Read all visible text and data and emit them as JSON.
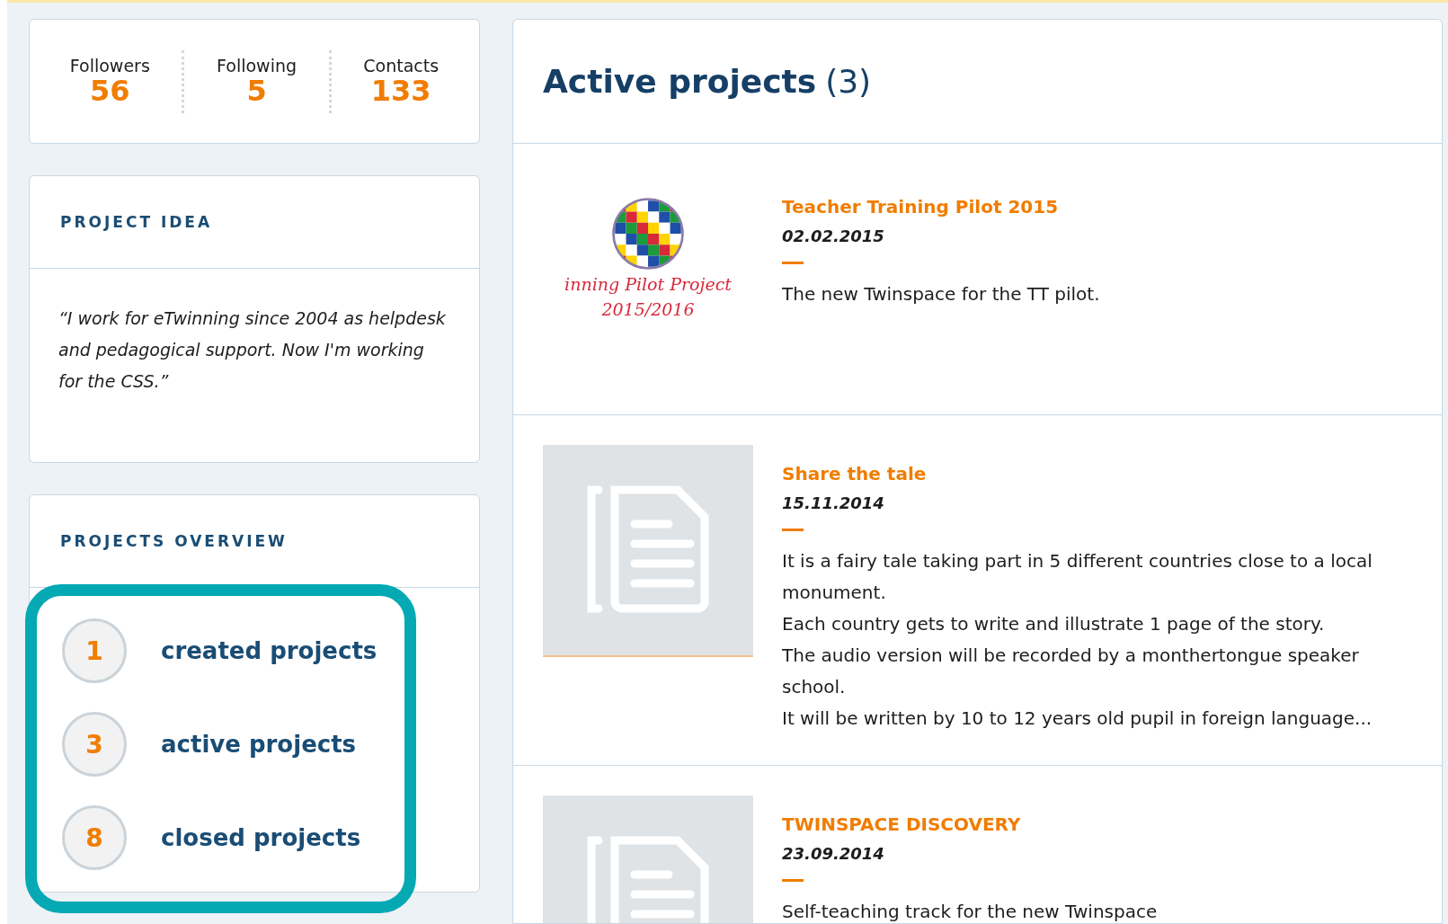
{
  "stats": [
    {
      "label": "Followers",
      "value": "56"
    },
    {
      "label": "Following",
      "value": "5"
    },
    {
      "label": "Contacts",
      "value": "133"
    }
  ],
  "project_idea": {
    "title": "PROJECT IDEA",
    "quote": "“I work for eTwinning since 2004 as helpdesk and pedagogical support. Now I'm working for the CSS.”"
  },
  "projects_overview": {
    "title": "PROJECTS OVERVIEW",
    "highlighted": true,
    "items": [
      {
        "count": "1",
        "label": "created projects"
      },
      {
        "count": "3",
        "label": "active projects"
      },
      {
        "count": "8",
        "label": "closed projects"
      }
    ]
  },
  "active_projects": {
    "title": "Active projects",
    "count": "(3)",
    "projects": [
      {
        "kind": "logo",
        "caption": [
          "inning Pilot Project",
          "2015/2016"
        ],
        "title": "Teacher Training Pilot 2015",
        "date": "02.02.2015",
        "description": [
          "The new Twinspace for the TT pilot."
        ]
      },
      {
        "kind": "placeholder",
        "title": "Share the tale",
        "date": "15.11.2014",
        "description": [
          "It is a fairy tale taking part in 5 different countries close to a local monument.",
          "Each country gets to write and illustrate 1 page of the story.",
          "The audio version will be recorded by a monthertongue speaker school.",
          "It will be written by 10 to 12 years old pupil in foreign language..."
        ]
      },
      {
        "kind": "placeholder",
        "title": "TWINSPACE DISCOVERY",
        "date": "23.09.2014",
        "description": [
          "Self-teaching track for the new Twinspace"
        ]
      }
    ]
  }
}
